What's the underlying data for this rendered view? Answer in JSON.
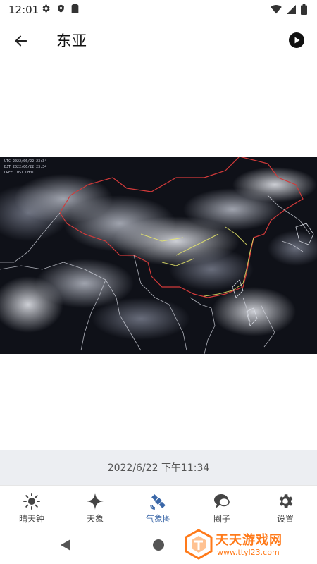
{
  "status_bar": {
    "time": "12:01",
    "left_icons": [
      "gear-icon",
      "shield-icon",
      "sim-card-icon"
    ],
    "right_icons": [
      "wifi-icon",
      "signal-icon",
      "battery-icon"
    ]
  },
  "app_bar": {
    "title": "东亚",
    "back_icon": "arrow-left-icon",
    "play_icon": "play-circle-icon"
  },
  "satellite": {
    "labels": [
      "UTC 2022/06/22 23:34",
      "BJT 2022/06/22 23:34",
      "CREF CMSI CH01"
    ]
  },
  "timestamp": "2022/6/22 下午11:34",
  "bottom_nav": {
    "items": [
      {
        "label": "晴天钟",
        "icon": "sun-icon"
      },
      {
        "label": "天象",
        "icon": "sparkle-star-icon"
      },
      {
        "label": "气象图",
        "icon": "satellite-icon",
        "active": true
      },
      {
        "label": "圈子",
        "icon": "chat-bubble-icon"
      },
      {
        "label": "设置",
        "icon": "gear-icon"
      }
    ],
    "active_color": "#3a67a8"
  },
  "watermark": {
    "title": "天天游戏网",
    "url": "www.ttyl23.com",
    "color": "#ff7a1a"
  }
}
